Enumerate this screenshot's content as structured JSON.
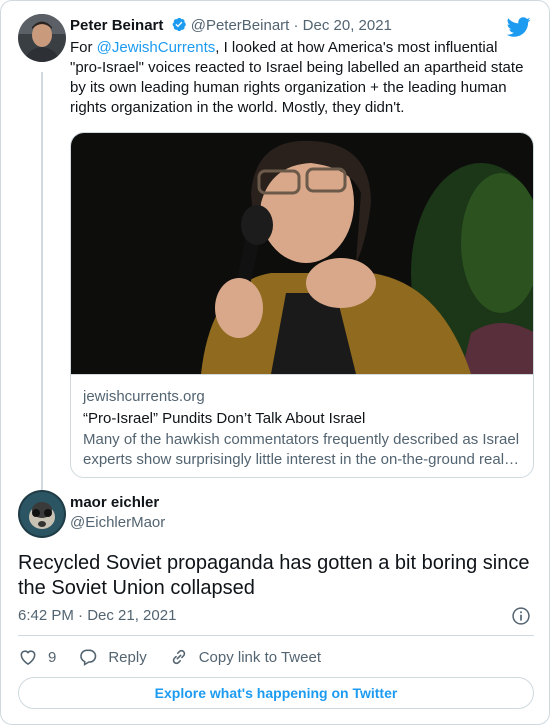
{
  "parent_tweet": {
    "name": "Peter Beinart",
    "handle": "@PeterBeinart",
    "separator": "·",
    "date": "Dec 20, 2021",
    "text_prefix": "For ",
    "mention": "@JewishCurrents",
    "text_suffix": ", I looked at how America's most influential \"pro-Israel\" voices reacted to Israel being labelled an apartheid state by its own leading human rights organization + the leading human rights organization in the world. Mostly, they didn't.",
    "avatar_icon": "profile-photo",
    "verified_icon": "verified-badge-icon"
  },
  "link_card": {
    "domain": "jewishcurrents.org",
    "title": "“Pro-Israel” Pundits Don’t Talk About Israel",
    "description": "Many of the hawkish commentators frequently described as Israel experts show surprisingly little interest in the on-the-ground real…"
  },
  "reply_tweet": {
    "name": "maor eichler",
    "handle": "@EichlerMaor",
    "text": "Recycled Soviet propaganda has gotten a bit boring since the Soviet Union collapsed",
    "time": "6:42 PM · Dec 21, 2021"
  },
  "actions": {
    "like_count": "9",
    "reply_label": "Reply",
    "copy_label": "Copy link to Tweet"
  },
  "footer": {
    "explore_label": "Explore what's happening on Twitter"
  },
  "colors": {
    "accent": "#1d9bf0",
    "secondary_text": "#536471",
    "border": "#cfd9de"
  }
}
